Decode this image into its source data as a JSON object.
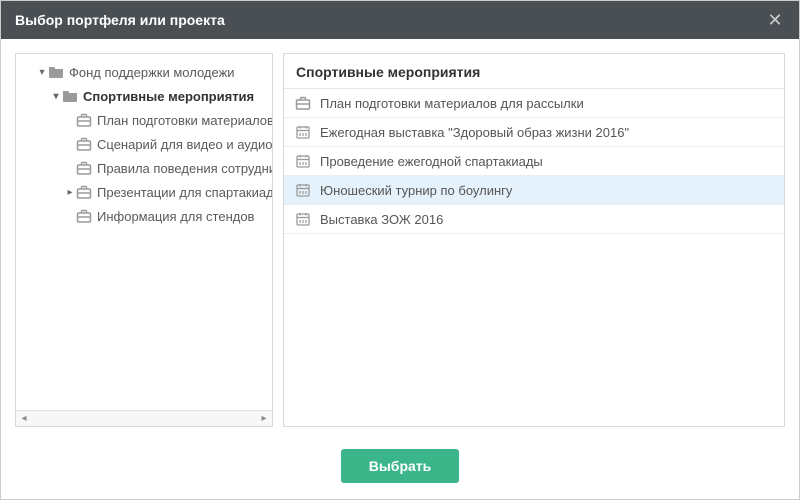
{
  "dialog": {
    "title": "Выбор портфеля или проекта"
  },
  "tree": {
    "nodes": [
      {
        "indent": 1,
        "toggle": "▾",
        "icon": "folder",
        "label": "Фонд поддержки молодежи",
        "selected": false
      },
      {
        "indent": 2,
        "toggle": "▾",
        "icon": "folder",
        "label": "Спортивные мероприятия",
        "selected": true
      },
      {
        "indent": 3,
        "toggle": "",
        "icon": "briefcase",
        "label": "План подготовки материалов для рассылки",
        "selected": false
      },
      {
        "indent": 3,
        "toggle": "",
        "icon": "briefcase",
        "label": "Сценарий для видео и аудиороликов",
        "selected": false
      },
      {
        "indent": 3,
        "toggle": "",
        "icon": "briefcase",
        "label": "Правила поведения сотрудников",
        "selected": false
      },
      {
        "indent": 3,
        "toggle": "▸",
        "icon": "briefcase",
        "label": "Презентации для спартакиады",
        "selected": false
      },
      {
        "indent": 3,
        "toggle": "",
        "icon": "briefcase",
        "label": "Информация для стендов",
        "selected": false
      }
    ]
  },
  "list": {
    "header": "Спортивные мероприятия",
    "items": [
      {
        "icon": "briefcase",
        "label": "План подготовки материалов для рассылки",
        "highlight": false
      },
      {
        "icon": "calendar",
        "label": "Ежегодная выставка \"Здоровый образ жизни 2016\"",
        "highlight": false
      },
      {
        "icon": "calendar",
        "label": "Проведение ежегодной спартакиады",
        "highlight": false
      },
      {
        "icon": "calendar",
        "label": "Юношеский турнир по боулингу",
        "highlight": true
      },
      {
        "icon": "calendar",
        "label": "Выставка ЗОЖ 2016",
        "highlight": false
      }
    ]
  },
  "buttons": {
    "select": "Выбрать"
  },
  "colors": {
    "primary": "#3bb58a",
    "titlebar": "#4a4f54",
    "highlight": "#e6f2fb"
  }
}
